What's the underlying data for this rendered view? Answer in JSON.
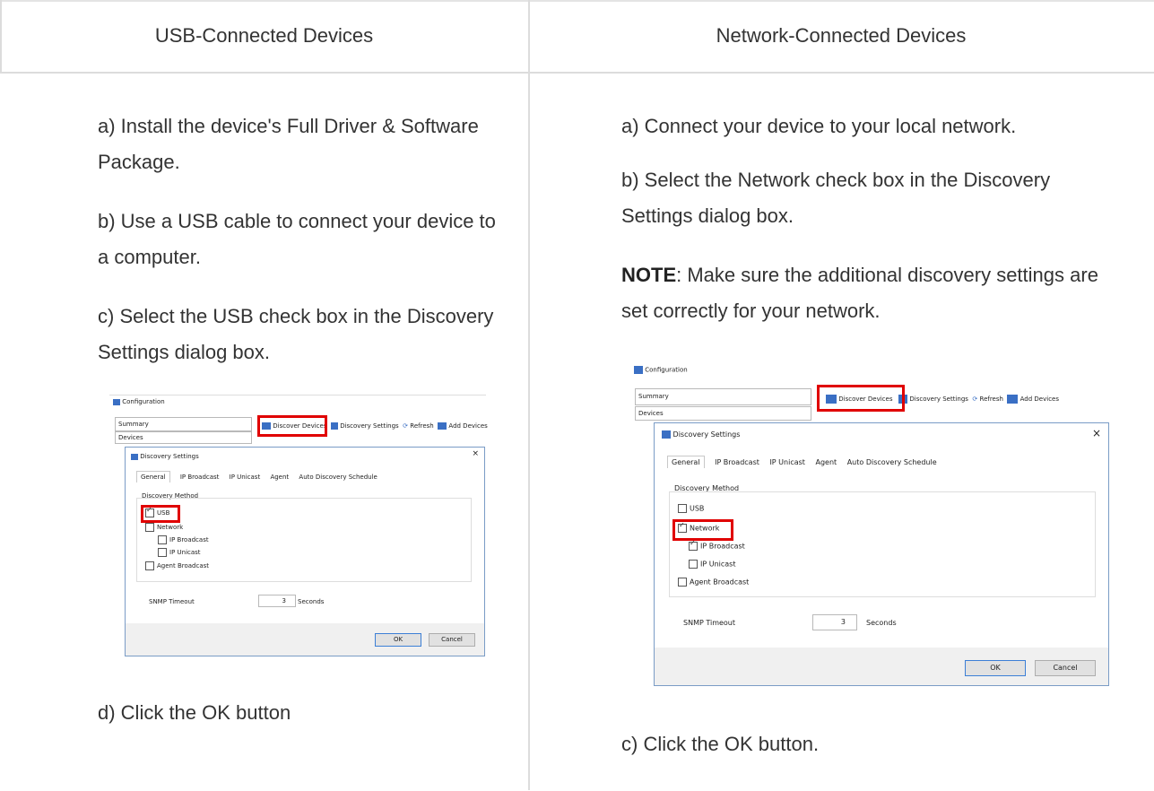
{
  "headers": {
    "usb": "USB-Connected Devices",
    "network": "Network-Connected Devices"
  },
  "usb_steps": {
    "a": "a) Install the device's Full Driver & Software Package.",
    "b": "b) Use a USB cable to connect your device to a computer.",
    "c": "c) Select the USB check box in the Discovery Settings dialog box.",
    "d": "d) Click the OK button"
  },
  "network_steps": {
    "a": "a) Connect your device to your local network.",
    "b": "b) Select the Network check box in the Discovery Settings dialog box.",
    "note_label": "NOTE",
    "note_text": ": Make sure the additional discovery settings are set correctly for your network.",
    "c": "c) Click the OK button."
  },
  "screenshot": {
    "config_title": "Configuration",
    "summary": "Summary",
    "devices": "Devices",
    "discover_devices": "Discover Devices",
    "discovery_settings_btn": "Discovery Settings",
    "refresh": "Refresh",
    "add_devices": "Add Devices",
    "dialog_title": "Discovery Settings",
    "close": "×",
    "tabs": [
      "General",
      "IP Broadcast",
      "IP Unicast",
      "Agent",
      "Auto Discovery Schedule"
    ],
    "group": "Discovery Method",
    "opt_usb": "USB",
    "opt_network": "Network",
    "opt_ip_broadcast": "IP Broadcast",
    "opt_ip_unicast": "IP Unicast",
    "opt_agent_broadcast": "Agent Broadcast",
    "snmp_label": "SNMP Timeout",
    "snmp_value": "3",
    "seconds": "Seconds",
    "ok": "OK",
    "cancel": "Cancel"
  }
}
